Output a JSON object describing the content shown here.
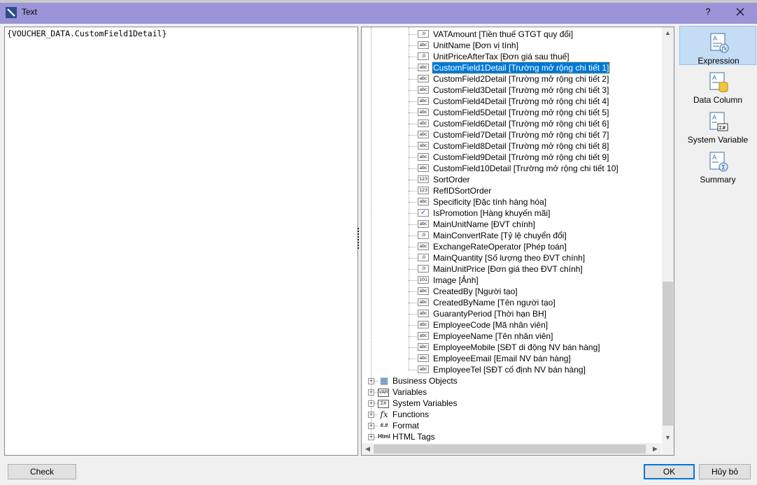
{
  "window": {
    "title": "Text",
    "help_label": "?"
  },
  "editor": {
    "content": "{VOUCHER_DATA.CustomField1Detail}"
  },
  "tree": {
    "fields": [
      {
        "icon": ".0",
        "label": "VATAmount [Tiền thuế GTGT quy đổi]"
      },
      {
        "icon": "abc",
        "label": "UnitName [Đơn vị tính]"
      },
      {
        "icon": ".0",
        "label": "UnitPriceAfterTax [Đơn giá sau thuế]"
      },
      {
        "icon": "abc",
        "label": "CustomField1Detail [Trường mở rộng chi tiết 1]",
        "selected": true
      },
      {
        "icon": "abc",
        "label": "CustomField2Detail [Trường mở rộng chi tiết 2]"
      },
      {
        "icon": "abc",
        "label": "CustomField3Detail [Trường mở rộng chi tiết 3]"
      },
      {
        "icon": "abc",
        "label": "CustomField4Detail [Trường mở rộng chi tiết 4]"
      },
      {
        "icon": "abc",
        "label": "CustomField5Detail [Trường mở rộng chi tiết 5]"
      },
      {
        "icon": "abc",
        "label": "CustomField6Detail [Trường mở rộng chi tiết 6]"
      },
      {
        "icon": "abc",
        "label": "CustomField7Detail [Trường mở rộng chi tiết 7]"
      },
      {
        "icon": "abc",
        "label": "CustomField8Detail [Trường mở rộng chi tiết 8]"
      },
      {
        "icon": "abc",
        "label": "CustomField9Detail [Trường mở rộng chi tiết 9]"
      },
      {
        "icon": "abc",
        "label": "CustomField10Detail [Trường mở rộng chi tiết 10]"
      },
      {
        "icon": "123",
        "label": "SortOrder"
      },
      {
        "icon": "123",
        "label": "RefIDSortOrder"
      },
      {
        "icon": "abc",
        "label": "Specificity [Đặc tính hàng hóa]"
      },
      {
        "icon": "✓",
        "label": "IsPromotion [Hàng khuyến mãi]"
      },
      {
        "icon": "abc",
        "label": "MainUnitName [ĐVT chính]"
      },
      {
        "icon": ".0",
        "label": "MainConvertRate [Tỷ lệ chuyển đổi]"
      },
      {
        "icon": "abc",
        "label": "ExchangeRateOperator [Phép toán]"
      },
      {
        "icon": ".0",
        "label": "MainQuantity [Số lượng theo ĐVT chính]"
      },
      {
        "icon": ".0",
        "label": "MainUnitPrice [Đơn giá theo ĐVT chính]"
      },
      {
        "icon": "101",
        "label": "Image [Ảnh]"
      },
      {
        "icon": "abc",
        "label": "CreatedBy [Người tạo]"
      },
      {
        "icon": "abc",
        "label": "CreatedByName [Tên người tạo]"
      },
      {
        "icon": "abc",
        "label": "GuarantyPeriod [Thời hạn BH]"
      },
      {
        "icon": "abc",
        "label": "EmployeeCode [Mã nhân viên]"
      },
      {
        "icon": "abc",
        "label": "EmployeeName [Tên nhân viên]"
      },
      {
        "icon": "abc",
        "label": "EmployeeMobile [SĐT di động NV bán hàng]"
      },
      {
        "icon": "abc",
        "label": "EmployeeEmail [Email NV bán hàng]"
      },
      {
        "icon": "abc",
        "label": "EmployeeTel [SĐT cố định NV bán hàng]"
      }
    ],
    "categories": [
      {
        "icon": "business-objects-icon",
        "glyph": "▦",
        "label": "Business Objects"
      },
      {
        "icon": "variables-icon",
        "glyph": "VAR",
        "label": "Variables"
      },
      {
        "icon": "system-variables-icon",
        "glyph": "Σ#",
        "label": "System Variables"
      },
      {
        "icon": "function-icon",
        "glyph": "fx",
        "label": "Functions"
      },
      {
        "icon": "format-icon",
        "glyph": "#.#",
        "label": "Format"
      },
      {
        "icon": "html-tags-icon",
        "glyph": "Html",
        "label": "HTML Tags"
      }
    ]
  },
  "side_panel": {
    "buttons": [
      {
        "id": "expression",
        "label": "Expression",
        "active": true
      },
      {
        "id": "data-column",
        "label": "Data Column"
      },
      {
        "id": "system-variable",
        "label": "System Variable"
      },
      {
        "id": "summary",
        "label": "Summary"
      }
    ]
  },
  "footer": {
    "check_label": "Check",
    "ok_label": "OK",
    "cancel_label": "Hủy bỏ"
  },
  "colors": {
    "title_bar": "#9b94d9",
    "selection": "#0078d7",
    "active_tab": "#c5dcf5"
  }
}
